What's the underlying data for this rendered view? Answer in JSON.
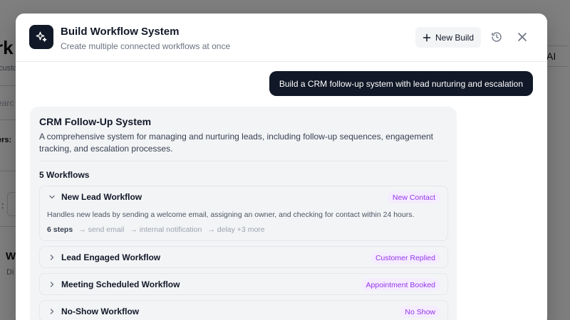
{
  "background": {
    "title": "rk",
    "subtitle": "custo",
    "search": "earc",
    "filter": "ers:",
    "colon": ":",
    "card_title": "W",
    "card_desc": "Di",
    "ai_label": "AI"
  },
  "modal": {
    "title": "Build Workflow System",
    "subtitle": "Create multiple connected workflows at once",
    "new_build_label": "New Build",
    "icons": {
      "logo": "sparkles-icon",
      "new_build": "plus-icon",
      "history": "history-icon",
      "close": "close-icon"
    }
  },
  "chat": {
    "user_message": "Build a CRM follow-up system with lead nurturing and escalation"
  },
  "system": {
    "title": "CRM Follow-Up System",
    "description": "A comprehensive system for managing and nurturing leads, including follow-up sequences, engagement tracking, and escalation processes.",
    "workflow_count_label": "5 Workflows",
    "workflows": [
      {
        "name": "New Lead Workflow",
        "trigger": "New Contact",
        "expanded": true,
        "description": "Handles new leads by sending a welcome email, assigning an owner, and checking for contact within 24 hours.",
        "steps_count": "6 steps",
        "steps": [
          "→ send email",
          "→ internal notification",
          "→ delay +3 more"
        ]
      },
      {
        "name": "Lead Engaged Workflow",
        "trigger": "Customer Replied",
        "expanded": false
      },
      {
        "name": "Meeting Scheduled Workflow",
        "trigger": "Appointment Booked",
        "expanded": false
      },
      {
        "name": "No-Show Workflow",
        "trigger": "No Show",
        "expanded": false
      }
    ]
  },
  "colors": {
    "dark": "#111827",
    "badge_bg": "#f5edff",
    "badge_text": "#9333ea",
    "card_bg": "#f3f4f6"
  }
}
